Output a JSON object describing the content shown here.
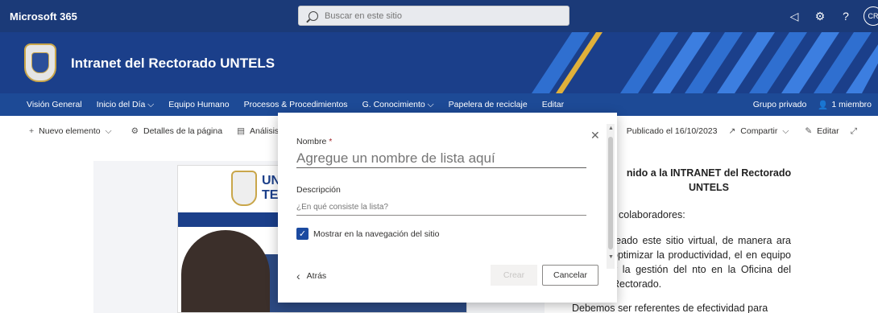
{
  "suite": {
    "brand": "Microsoft 365",
    "search_placeholder": "Buscar en este sitio",
    "avatar_initials": "CR"
  },
  "site": {
    "title": "Intranet del Rectorado UNTELS"
  },
  "nav": {
    "items": [
      "Visión General",
      "Inicio del Día ⌵",
      "Equipo Humano",
      "Procesos & Procedimientos",
      "G. Conocimiento ⌵",
      "Papelera de reciclaje",
      "Editar"
    ],
    "group_label": "Grupo privado",
    "members": "1 miembro"
  },
  "cmdbar": {
    "new_item": "Nuevo elemento",
    "page_details": "Detalles de la página",
    "analysis": "Análisis",
    "published": "Publicado el 16/10/2023",
    "share": "Compartir",
    "edit": "Editar"
  },
  "article": {
    "heading": "nido a la INTRANET del Rectorado UNTELS",
    "p1": "colaboradores:",
    "p2": "reado este sitio virtual, de manera ara optimizar la productividad, el en equipo y la gestión del nto en la Oficina del Rectorado.",
    "p3": "Debemos ser referentes de efectividad para"
  },
  "flyer": {
    "emblem_text": "UN\nTEC"
  },
  "dialog": {
    "name_label": "Nombre",
    "required_mark": "*",
    "name_placeholder": "Agregue un nombre de lista aquí",
    "desc_label": "Descripción",
    "desc_placeholder": "¿En qué consiste la lista?",
    "show_in_nav_label": "Mostrar en la navegación del sitio",
    "show_in_nav_checked": true,
    "back_label": "Atrás",
    "create_label": "Crear",
    "cancel_label": "Cancelar"
  },
  "colors": {
    "suite_bar": "#1b3a78",
    "header": "#1b3f8a",
    "nav": "#1d4a96",
    "accent": "#1b4aa0"
  }
}
